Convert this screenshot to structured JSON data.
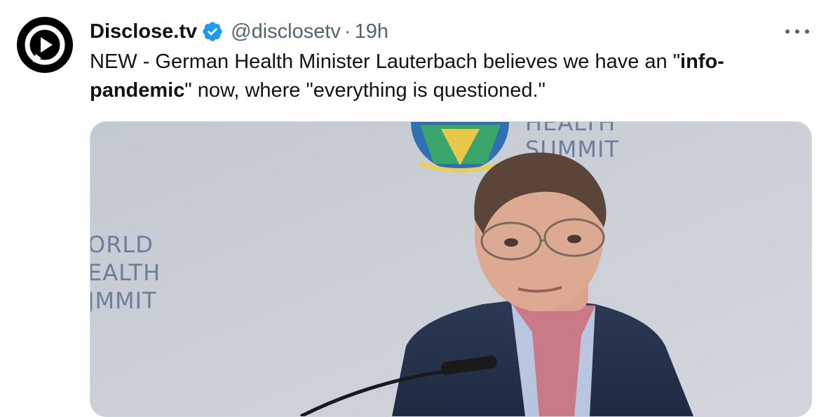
{
  "tweet": {
    "author_name": "Disclose.tv",
    "handle": "@disclosetv",
    "separator": "·",
    "time": "19h",
    "text_parts": [
      "NEW - German Health Minister Lauterbach believes we have an \"",
      "info-pandemic",
      "\" now, where \"everything is questioned.\""
    ],
    "text_bold_line1": "info-",
    "text_bold_line2": "pandemic",
    "text_line1_pre": "NEW - German Health Minister Lauterbach believes we have an \"",
    "text_line2_post": "\" now, where \"everything is questioned.\""
  },
  "media": {
    "watermark_left": [
      "ORLD",
      "EALTH",
      "JMMIT"
    ],
    "watermark_top": [
      "HEALTH",
      "SUMMIT"
    ]
  },
  "colors": {
    "verified": "#1d9bf0",
    "secondary_text": "#536471",
    "border": "#cfd9de"
  },
  "icons": {
    "verified": "verified-badge-icon",
    "more": "more-options-icon"
  }
}
